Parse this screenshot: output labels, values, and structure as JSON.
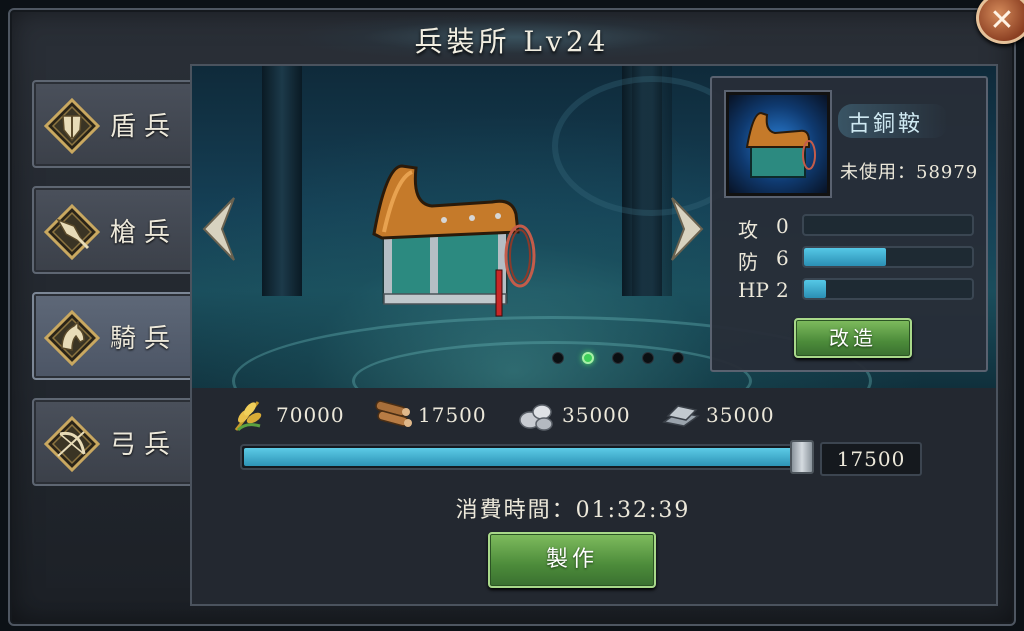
{
  "header": {
    "title": "兵裝所 Lv24",
    "close_symbol": "✕"
  },
  "sidebar": {
    "items": [
      {
        "label": "盾兵",
        "icon": "shield-icon"
      },
      {
        "label": "槍兵",
        "icon": "spear-icon"
      },
      {
        "label": "騎兵",
        "icon": "horse-icon"
      },
      {
        "label": "弓兵",
        "icon": "bow-icon"
      }
    ],
    "active_index": 2
  },
  "carousel": {
    "dots": 5,
    "active_dot": 1,
    "prev_icon": "chevron-left-icon",
    "next_icon": "chevron-right-icon",
    "item_visual": "saddle"
  },
  "item_panel": {
    "name": "古銅鞍",
    "unused": "未使用：58979",
    "stats": [
      {
        "label": "攻",
        "value": "0",
        "fill_pct": 0
      },
      {
        "label": "防",
        "value": "6",
        "fill_pct": 49
      },
      {
        "label": "HP",
        "value": "2",
        "fill_pct": 13
      }
    ],
    "upgrade_label": "改造"
  },
  "resources": [
    {
      "icon": "grain-icon",
      "amount": "70000"
    },
    {
      "icon": "wood-icon",
      "amount": "17500"
    },
    {
      "icon": "stone-icon",
      "amount": "35000"
    },
    {
      "icon": "iron-icon",
      "amount": "35000"
    }
  ],
  "quantity": {
    "slider_fill_pct": 100,
    "value": "17500"
  },
  "time_text": "消費時間：01:32:39",
  "craft_label": "製作",
  "colors": {
    "accent_blue": "#3aaed0",
    "button_green": "#5c9d45"
  }
}
